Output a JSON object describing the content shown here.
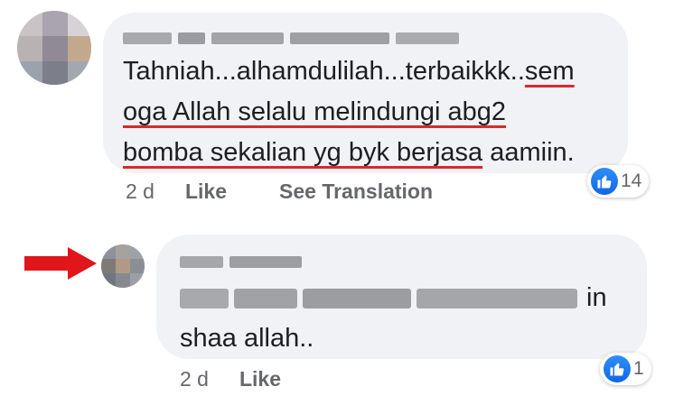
{
  "comments": [
    {
      "author": "",
      "text_plain": "Tahniah...alhamdulilah...terbaikkk..",
      "text_underlined_1": "sem",
      "line2": "oga Allah selalu melindungi abg2",
      "line3_underlined": "bomba sekalian yg byk berjasa",
      "line3_rest": " aamiin.",
      "time": "2 d",
      "like_label": "Like",
      "translate_label": "See Translation",
      "reaction_count": "14",
      "reaction_icon": "thumbs-up-icon"
    },
    {
      "author": "",
      "mention": "",
      "text_after_mention": "in",
      "line2": "shaa allah..",
      "time": "2 d",
      "like_label": "Like",
      "reaction_count": "1",
      "reaction_icon": "thumbs-up-icon"
    }
  ],
  "annotation": {
    "arrow_color": "#e0161b",
    "icon": "red-arrow-icon"
  },
  "colors": {
    "bubble": "#f0f2f5",
    "like_blue": "#1877f2",
    "underline_red": "#d62b2b"
  }
}
